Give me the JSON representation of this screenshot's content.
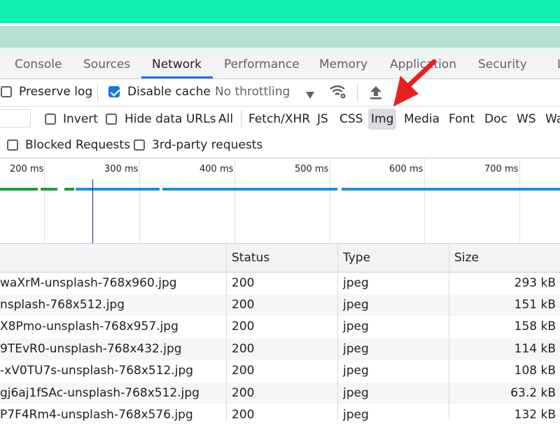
{
  "tabs": [
    {
      "label": "Console"
    },
    {
      "label": "Sources"
    },
    {
      "label": "Network"
    },
    {
      "label": "Performance"
    },
    {
      "label": "Memory"
    },
    {
      "label": "Application"
    },
    {
      "label": "Security"
    },
    {
      "label": "L"
    }
  ],
  "toolbar": {
    "preserve_log_label": "Preserve log",
    "preserve_log_checked": false,
    "disable_cache_label": "Disable cache",
    "disable_cache_checked": true,
    "throttling_value": "No throttling"
  },
  "filters": {
    "invert_label": "Invert",
    "hide_data_urls_label": "Hide data URLs",
    "types": [
      "All",
      "Fetch/XHR",
      "JS",
      "CSS",
      "Img",
      "Media",
      "Font",
      "Doc",
      "WS",
      "Wa"
    ],
    "selected_type": "Img",
    "blocked_requests_label": "Blocked Requests",
    "third_party_label": "3rd-party requests"
  },
  "timeline": {
    "ticks": [
      "200 ms",
      "300 ms",
      "400 ms",
      "500 ms",
      "600 ms",
      "700 ms"
    ]
  },
  "table": {
    "headers": [
      "Status",
      "Type",
      "Size"
    ],
    "rows": [
      {
        "name": "waXrM-unsplash-768x960.jpg",
        "status": "200",
        "type": "jpeg",
        "size": "293 kB"
      },
      {
        "name": "nsplash-768x512.jpg",
        "status": "200",
        "type": "jpeg",
        "size": "151 kB"
      },
      {
        "name": "X8Pmo-unsplash-768x957.jpg",
        "status": "200",
        "type": "jpeg",
        "size": "158 kB"
      },
      {
        "name": "9TEvR0-unsplash-768x432.jpg",
        "status": "200",
        "type": "jpeg",
        "size": "114 kB"
      },
      {
        "name": "-xV0TU7s-unsplash-768x512.jpg",
        "status": "200",
        "type": "jpeg",
        "size": "108 kB"
      },
      {
        "name": "gj6aj1fSAc-unsplash-768x512.jpg",
        "status": "200",
        "type": "jpeg",
        "size": "63.2 kB"
      },
      {
        "name": "P7F4Rm4-unsplash-768x576.jpg",
        "status": "200",
        "type": "jpeg",
        "size": "132 kB"
      }
    ]
  },
  "colors": {
    "accent": "#1a73e8",
    "top_band": "#12f0ad",
    "annotation_arrow": "#e8211e"
  },
  "icons": [
    "wifi-settings-icon",
    "import-icon",
    "dropdown-triangle-icon",
    "annotation-arrow-icon"
  ]
}
